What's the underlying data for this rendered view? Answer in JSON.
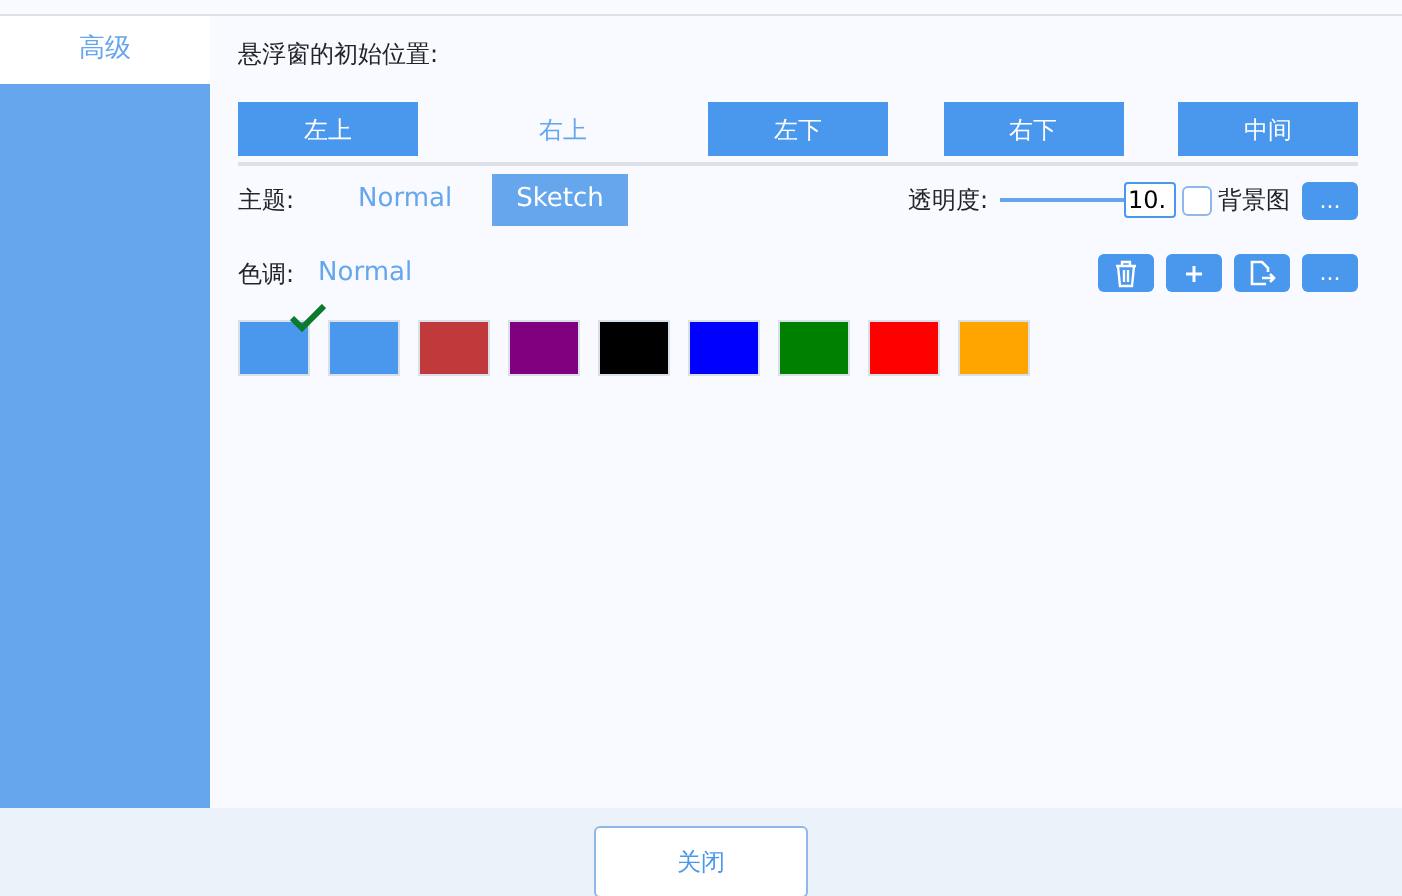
{
  "sidebar": {
    "items": [
      {
        "label": "高级",
        "selected": true
      }
    ]
  },
  "position": {
    "label": "悬浮窗的初始位置:",
    "options": [
      {
        "label": "左上",
        "selected": false
      },
      {
        "label": "右上",
        "selected": true
      },
      {
        "label": "左下",
        "selected": false
      },
      {
        "label": "右下",
        "selected": false
      },
      {
        "label": "中间",
        "selected": false
      }
    ]
  },
  "theme": {
    "label": "主题:",
    "options": [
      {
        "label": "Normal",
        "selected": true
      },
      {
        "label": "Sketch",
        "selected": false
      }
    ]
  },
  "opacity": {
    "label": "透明度:",
    "level": 1,
    "value": "10."
  },
  "background_image": {
    "label": "背景图",
    "checked": false,
    "button": "..."
  },
  "tone": {
    "label": "色调:",
    "value": "Normal",
    "more_button": "..."
  },
  "swatches": [
    {
      "color": "#4a97ee",
      "selected": true
    },
    {
      "color": "#4a97ee",
      "selected": false
    },
    {
      "color": "#c0393b",
      "selected": false
    },
    {
      "color": "#800080",
      "selected": false
    },
    {
      "color": "#000000",
      "selected": false
    },
    {
      "color": "#0000ff",
      "selected": false
    },
    {
      "color": "#008000",
      "selected": false
    },
    {
      "color": "#ff0000",
      "selected": false
    },
    {
      "color": "#ffa500",
      "selected": false
    }
  ],
  "footer": {
    "close_button": "关闭"
  }
}
